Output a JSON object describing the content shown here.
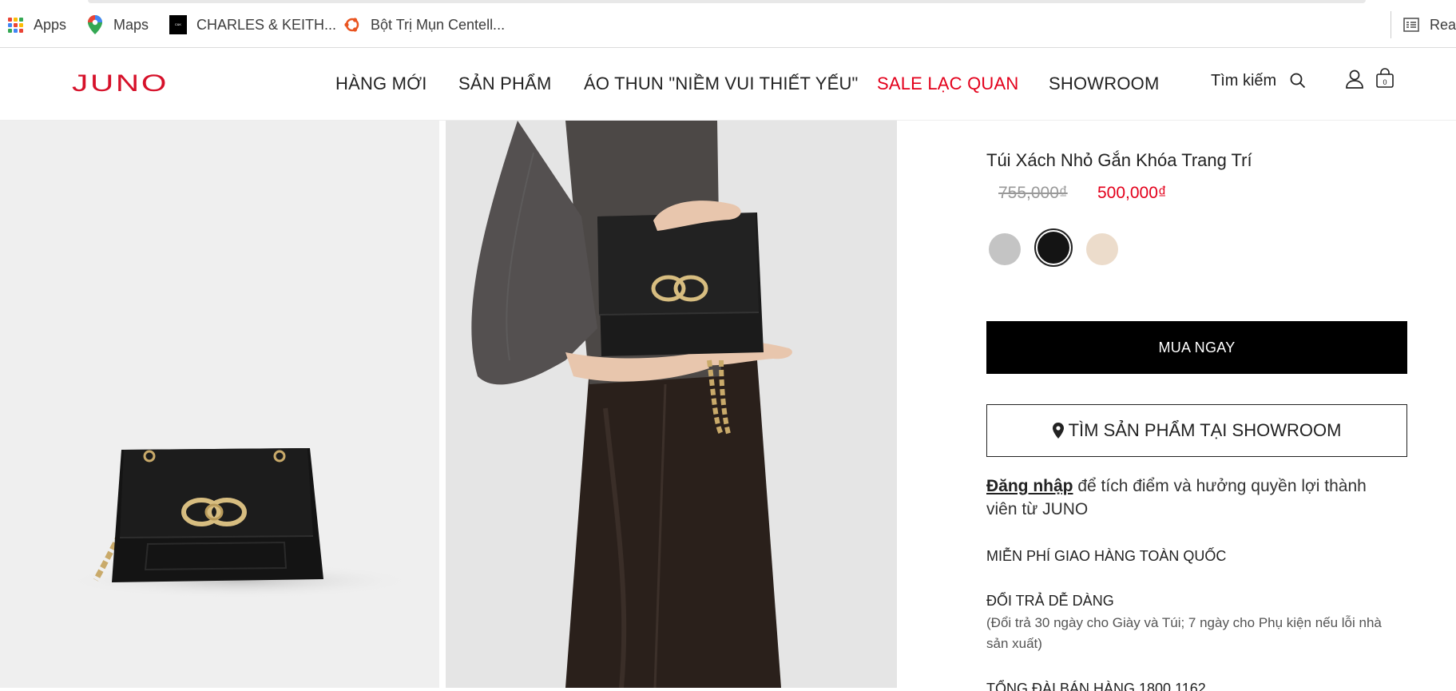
{
  "bookmarks": [
    {
      "label": "Apps",
      "icon": "apps-grid-icon"
    },
    {
      "label": "Maps",
      "icon": "maps-pin-icon"
    },
    {
      "label": "CHARLES & KEITH...",
      "icon": "charles-keith-logo-icon"
    },
    {
      "label": "Bột Trị Mụn Centell...",
      "icon": "ubuntu-logo-icon"
    },
    {
      "label": "Rea",
      "icon": "reading-list-icon"
    }
  ],
  "header": {
    "logo": "JUNO",
    "nav": [
      {
        "label": "HÀNG MỚI"
      },
      {
        "label": "SẢN PHẨM"
      },
      {
        "label": "ÁO THUN \"NIỀM VUI THIẾT YẾU\""
      },
      {
        "label": "SALE LẠC QUAN"
      },
      {
        "label": "SHOWROOM"
      }
    ],
    "search_label": "Tìm kiếm",
    "cart_count": "0"
  },
  "product": {
    "title": "Túi Xách Nhỏ Gắn Khóa Trang Trí",
    "price_old": "755,000₫",
    "price_new": "500,000₫",
    "swatches": [
      {
        "color": "#c4c4c4",
        "selected": false
      },
      {
        "color": "#141414",
        "selected": true
      },
      {
        "color": "#ecdccb",
        "selected": false
      }
    ],
    "buy_label": "MUA NGAY",
    "store_label": "TÌM SẢN PHẨM TẠI SHOWROOM",
    "login_link": "Đăng nhập",
    "login_text": " để tích điểm và hưởng quyền lợi thành viên từ JUNO",
    "shipping": "MIỄN PHÍ GIAO HÀNG TOÀN QUỐC",
    "returns_title": "ĐỔI TRẢ DỄ DÀNG",
    "returns_detail": "(Đổi trả 30 ngày cho Giày và Túi; 7 ngày cho Phụ kiện nếu lỗi nhà sản xuất)",
    "hotline": "TỔNG ĐÀI BÁN HÀNG 1800 1162"
  },
  "colors": {
    "brand_red": "#d6112a",
    "sale_red": "#e3001b",
    "button_black": "#000000"
  }
}
